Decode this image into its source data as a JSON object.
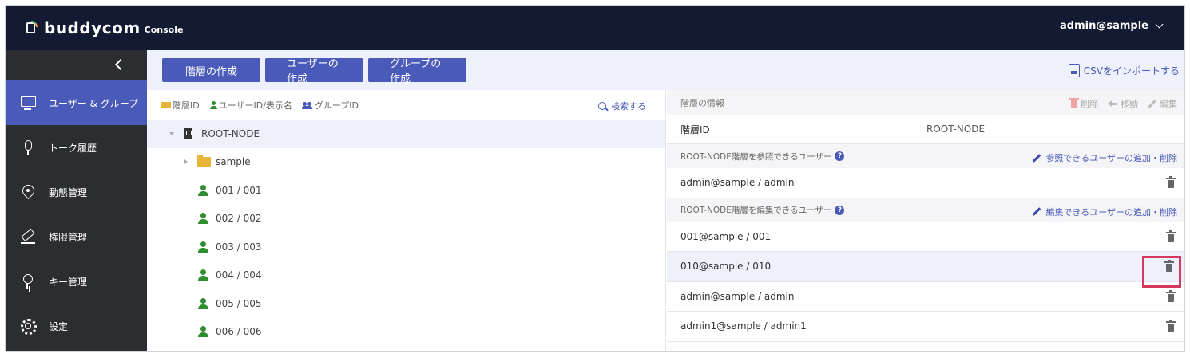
{
  "header": {
    "logo_text": "buddycom",
    "logo_sub": "Console",
    "user": "admin@sample"
  },
  "sidebar": {
    "items": [
      {
        "label": "ユーザー & グループ",
        "icon": "monitor-icon",
        "active": true
      },
      {
        "label": "トーク履歴",
        "icon": "microphone-icon"
      },
      {
        "label": "動態管理",
        "icon": "location-pin-icon"
      },
      {
        "label": "権限管理",
        "icon": "hammer-icon"
      },
      {
        "label": "キー管理",
        "icon": "key-icon"
      },
      {
        "label": "設定",
        "icon": "gear-icon"
      }
    ]
  },
  "toolbar": {
    "create_hierarchy": "階層の作成",
    "create_user": "ユーザーの作成",
    "create_group": "グループの作成",
    "csv_import": "CSVをインポートする"
  },
  "tree": {
    "legend_hierarchy": "階層ID",
    "legend_user": "ユーザーID/表示名",
    "legend_group": "グループID",
    "search": "検索する",
    "root": "ROOT-NODE",
    "folder": "sample",
    "users": [
      "001 / 001",
      "002 / 002",
      "003 / 003",
      "004 / 004",
      "005 / 005",
      "006 / 006"
    ]
  },
  "info": {
    "title": "階層の情報",
    "delete": "削除",
    "move": "移動",
    "edit": "編集",
    "id_label": "階層ID",
    "id_value": "ROOT-NODE",
    "view_section": "ROOT-NODE階層を参照できるユーザー",
    "view_link": "参照できるユーザーの追加・削除",
    "view_users": [
      "admin@sample / admin"
    ],
    "edit_section": "ROOT-NODE階層を編集できるユーザー",
    "edit_link": "編集できるユーザーの追加・削除",
    "edit_users": [
      "001@sample / 001",
      "010@sample / 010",
      "admin@sample / admin",
      "admin1@sample / admin1"
    ]
  },
  "colors": {
    "header_bg": "#131b33",
    "sidebar_bg": "#2b2d31",
    "accent": "#4a5ab8",
    "highlight": "#d33a5e"
  }
}
